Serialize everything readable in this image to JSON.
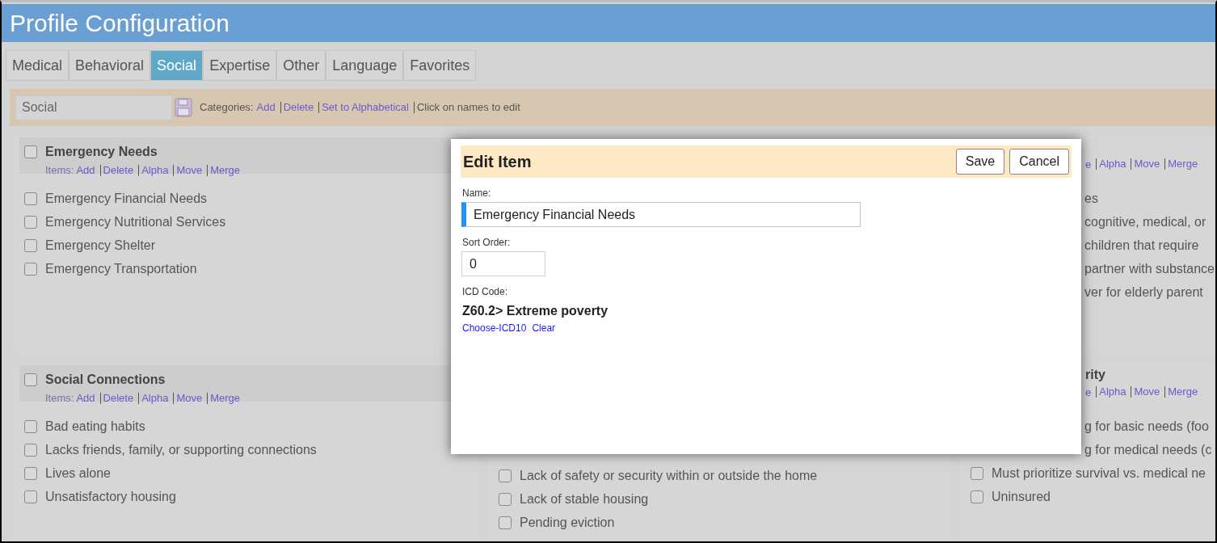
{
  "header": {
    "title": "Profile Configuration"
  },
  "tabs": [
    {
      "label": "Medical",
      "selected": false
    },
    {
      "label": "Behavioral",
      "selected": false
    },
    {
      "label": "Social",
      "selected": true
    },
    {
      "label": "Expertise",
      "selected": false
    },
    {
      "label": "Other",
      "selected": false
    },
    {
      "label": "Language",
      "selected": false
    },
    {
      "label": "Favorites",
      "selected": false
    }
  ],
  "toolbar": {
    "name_value": "Social",
    "categories_label": "Categories:",
    "links": [
      "Add",
      "Delete",
      "Set to Alphabetical"
    ],
    "hint": "Click on names to edit"
  },
  "categories": [
    {
      "kind": "full",
      "title": "Emergency Needs",
      "checked": false,
      "links_label": "Items:",
      "links": [
        "Add",
        "Delete",
        "Alpha",
        "Move",
        "Merge"
      ],
      "items": [
        {
          "kind": "checkbox",
          "label": "Emergency Financial Needs",
          "checked": false
        },
        {
          "kind": "checkbox",
          "label": "Emergency Nutritional Services",
          "checked": false
        },
        {
          "kind": "checkbox",
          "label": "Emergency Shelter",
          "checked": false
        },
        {
          "kind": "checkbox",
          "label": "Emergency Transportation",
          "checked": false
        }
      ]
    },
    {
      "kind": "covered"
    },
    {
      "kind": "right-fragment",
      "links": [
        "e",
        "Alpha",
        "Move",
        "Merge"
      ],
      "items": [
        {
          "kind": "fragment",
          "label": "es"
        },
        {
          "kind": "fragment",
          "label": "cognitive, medical, or"
        },
        {
          "kind": "fragment",
          "label": "children that require"
        },
        {
          "kind": "fragment",
          "label": "partner with substance"
        },
        {
          "kind": "fragment",
          "label": "ver for elderly parent"
        }
      ]
    },
    {
      "kind": "full",
      "title": "Social Connections",
      "checked": false,
      "links_label": "Items:",
      "links": [
        "Add",
        "Delete",
        "Alpha",
        "Move",
        "Merge"
      ],
      "items": [
        {
          "kind": "checkbox",
          "label": "Bad eating habits",
          "checked": false
        },
        {
          "kind": "checkbox",
          "label": "Lacks friends, family, or supporting connections",
          "checked": false
        },
        {
          "kind": "checkbox",
          "label": "Lives alone",
          "checked": false
        },
        {
          "kind": "checkbox",
          "label": "Unsatisfactory housing",
          "checked": false
        }
      ]
    },
    {
      "kind": "covered-top",
      "items": [
        {
          "kind": "checkbox",
          "label": "Lack of safety or security within or outside the home",
          "checked": false
        },
        {
          "kind": "checkbox",
          "label": "Lack of stable housing",
          "checked": false
        },
        {
          "kind": "checkbox",
          "label": "Pending eviction",
          "checked": false
        }
      ]
    },
    {
      "kind": "right-fragment",
      "title": "rity",
      "links": [
        "e",
        "Alpha",
        "Move",
        "Merge"
      ],
      "items": [
        {
          "kind": "fragment",
          "label": "g for basic needs (foo"
        },
        {
          "kind": "fragment",
          "label": "g for medical needs (c"
        },
        {
          "kind": "checkbox",
          "label": "Must prioritize survival vs. medical ne",
          "checked": false
        },
        {
          "kind": "checkbox",
          "label": "Uninsured",
          "checked": false
        }
      ]
    }
  ],
  "modal": {
    "title": "Edit Item",
    "buttons": [
      "Save",
      "Cancel"
    ],
    "fields": [
      {
        "kind": "wide",
        "label": "Name:",
        "value": "Emergency Financial Needs",
        "focused": true
      },
      {
        "kind": "narrow",
        "label": "Sort Order:",
        "value": "0",
        "focused": false
      }
    ],
    "icd": {
      "label": "ICD Code:",
      "value": "Z60.2> Extreme poverty",
      "links": [
        "Choose-ICD10",
        "Clear"
      ]
    }
  }
}
